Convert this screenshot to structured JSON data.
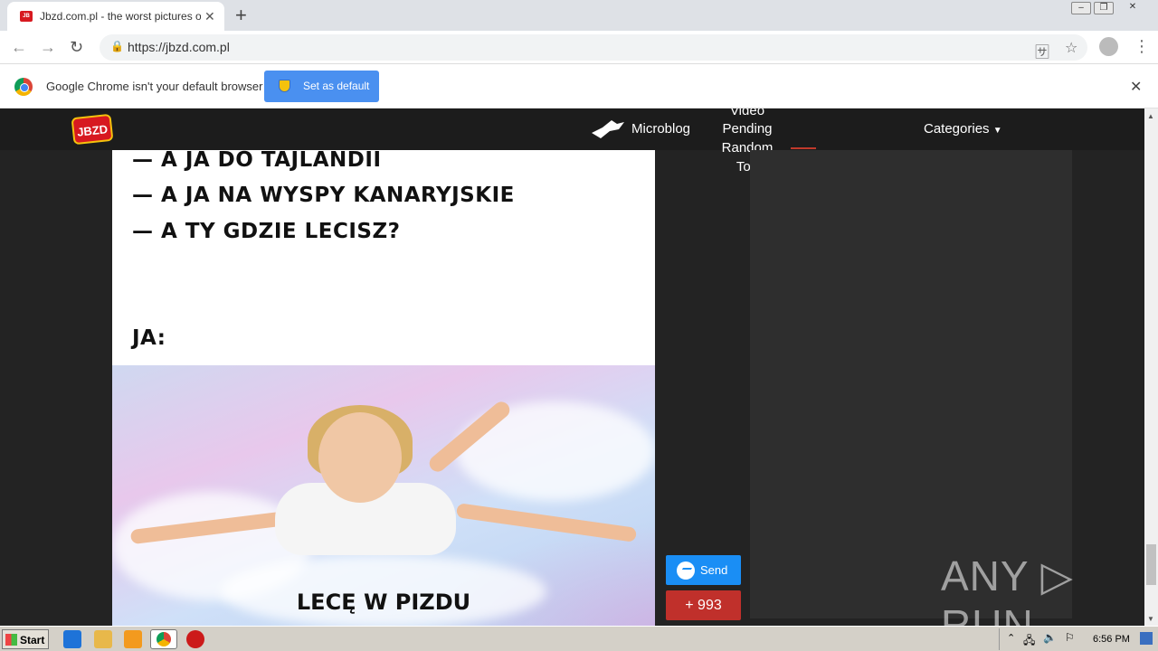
{
  "browser": {
    "tab_title": "Jbzd.com.pl - the worst pictures on t",
    "url": "https://jbzd.com.pl",
    "infobar_text": "Google Chrome isn't your default browser",
    "set_default_label": "Set as default"
  },
  "site": {
    "logo_text": "JBZD",
    "nav": {
      "microblog": "Microblog",
      "video": "Video",
      "pending": "Pending",
      "random": "Random",
      "top": "Top",
      "categories": "Categories"
    }
  },
  "meme": {
    "lines": [
      "— A JA DO TAJLANDII",
      "— A JA NA WYSPY KANARYJSKIE",
      "— A TY GDZIE LECISZ?"
    ],
    "ja": "JA:",
    "caption": "LECĘ W PIZDU"
  },
  "actions": {
    "send_label": "Send",
    "votes": "+ 993"
  },
  "watermark": "ANY ▷ RUN",
  "taskbar": {
    "start_label": "Start",
    "clock": "6:56 PM"
  }
}
